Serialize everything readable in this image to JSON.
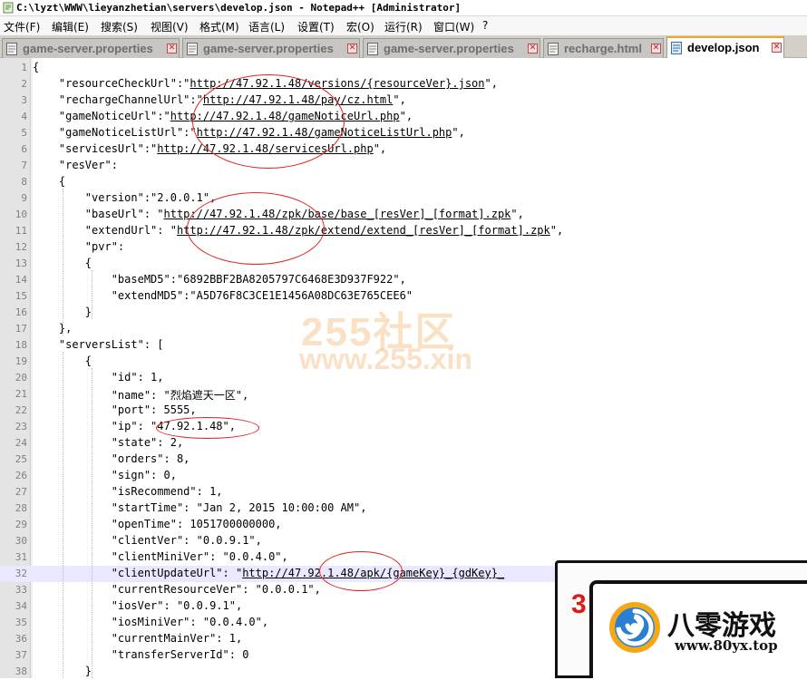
{
  "window": {
    "title": "C:\\lyzt\\WWW\\lieyanzhetian\\servers\\develop.json - Notepad++ [Administrator]"
  },
  "menu": [
    "文件(F)",
    "编辑(E)",
    "搜索(S)",
    "视图(V)",
    "格式(M)",
    "语言(L)",
    "设置(T)",
    "宏(O)",
    "运行(R)",
    "窗口(W)",
    "?"
  ],
  "tabs": [
    {
      "label": "game-server.properties",
      "active": false
    },
    {
      "label": "game-server.properties",
      "active": false
    },
    {
      "label": "game-server.properties",
      "active": false
    },
    {
      "label": "recharge.html",
      "active": false
    },
    {
      "label": "develop.json",
      "active": true
    }
  ],
  "editor": {
    "current_line": 32,
    "lines": [
      "{",
      "    \"resourceCheckUrl\":\"http://47.92.1.48/versions/{resourceVer}.json\",",
      "    \"rechargeChannelUrl\":\"http://47.92.1.48/pay/cz.html\",",
      "    \"gameNoticeUrl\":\"http://47.92.1.48/gameNoticeUrl.php\",",
      "    \"gameNoticeListUrl\":\"http://47.92.1.48/gameNoticeListUrl.php\",",
      "    \"servicesUrl\":\"http://47.92.1.48/servicesUrl.php\",",
      "    \"resVer\":",
      "    {",
      "        \"version\":\"2.0.0.1\",",
      "        \"baseUrl\": \"http://47.92.1.48/zpk/base/base_[resVer]_[format].zpk\",",
      "        \"extendUrl\": \"http://47.92.1.48/zpk/extend/extend_[resVer]_[format].zpk\",",
      "        \"pvr\":",
      "        {",
      "            \"baseMD5\":\"6892BBF2BA8205797C6468E3D937F922\",",
      "            \"extendMD5\":\"A5D76F8C3CE1E1456A08DC63E765CEE6\"",
      "        }",
      "    },",
      "    \"serversList\": [",
      "        {",
      "            \"id\": 1,",
      "            \"name\": \"烈焰遮天一区\",",
      "            \"port\": 5555,",
      "            \"ip\": \"47.92.1.48\",",
      "            \"state\": 2,",
      "            \"orders\": 8,",
      "            \"sign\": 0,",
      "            \"isRecommend\": 1,",
      "            \"startTime\": \"Jan 2, 2015 10:00:00 AM\",",
      "            \"openTime\": 1051700000000,",
      "            \"clientVer\": \"0.0.9.1\",",
      "            \"clientMiniVer\": \"0.0.4.0\",",
      "            \"clientUpdateUrl\": \"http://47.92.1.48/apk/{gameKey}_{gdKey}_",
      "            \"currentResourceVer\": \"0.0.0.1\",",
      "            \"iosVer\": \"0.0.9.1\",",
      "            \"iosMiniVer\": \"0.0.4.0\",",
      "            \"currentMainVer\": 1,",
      "            \"transferServerId\": 0",
      "        }"
    ]
  },
  "watermark": {
    "line1": "255社区",
    "line2": "www.255.xin"
  },
  "stamp": {
    "red_text": "3",
    "brand": "八零游戏",
    "url": "www.80yx.top"
  }
}
